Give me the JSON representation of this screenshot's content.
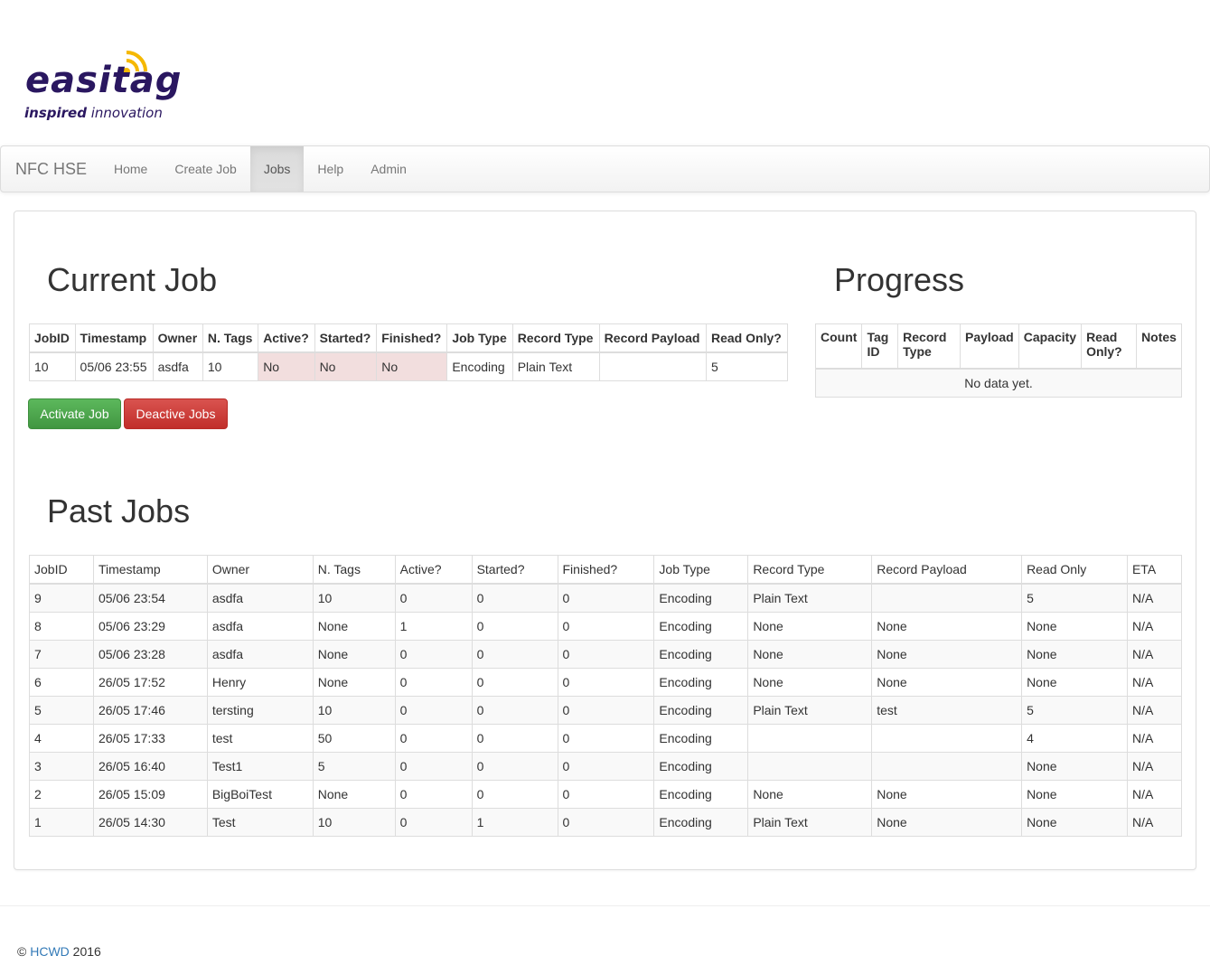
{
  "logo": {
    "word": "easitag",
    "tagline_bold": "inspired",
    "tagline_rest": " innovation"
  },
  "nav": {
    "brand": "NFC HSE",
    "links": [
      "Home",
      "Create Job",
      "Jobs",
      "Help",
      "Admin"
    ],
    "active": "Jobs"
  },
  "current_job": {
    "title": "Current Job",
    "headers": [
      "JobID",
      "Timestamp",
      "Owner",
      "N. Tags",
      "Active?",
      "Started?",
      "Finished?",
      "Job Type",
      "Record Type",
      "Record Payload",
      "Read Only?"
    ],
    "row": [
      "10",
      "05/06 23:55",
      "asdfa",
      "10",
      "No",
      "No",
      "No",
      "Encoding",
      "Plain Text",
      "",
      "5"
    ]
  },
  "buttons": {
    "activate": "Activate Job",
    "deactivate": "Deactive Jobs"
  },
  "progress": {
    "title": "Progress",
    "headers": [
      "Count",
      "Tag ID",
      "Record Type",
      "Payload",
      "Capacity",
      "Read Only?",
      "Notes"
    ],
    "empty": "No data yet."
  },
  "past_jobs": {
    "title": "Past Jobs",
    "headers": [
      "JobID",
      "Timestamp",
      "Owner",
      "N. Tags",
      "Active?",
      "Started?",
      "Finished?",
      "Job Type",
      "Record Type",
      "Record Payload",
      "Read Only",
      "ETA"
    ],
    "rows": [
      [
        "9",
        "05/06 23:54",
        "asdfa",
        "10",
        "0",
        "0",
        "0",
        "Encoding",
        "Plain Text",
        "",
        "5",
        "N/A"
      ],
      [
        "8",
        "05/06 23:29",
        "asdfa",
        "None",
        "1",
        "0",
        "0",
        "Encoding",
        "None",
        "None",
        "None",
        "N/A"
      ],
      [
        "7",
        "05/06 23:28",
        "asdfa",
        "None",
        "0",
        "0",
        "0",
        "Encoding",
        "None",
        "None",
        "None",
        "N/A"
      ],
      [
        "6",
        "26/05 17:52",
        "Henry",
        "None",
        "0",
        "0",
        "0",
        "Encoding",
        "None",
        "None",
        "None",
        "N/A"
      ],
      [
        "5",
        "26/05 17:46",
        "tersting",
        "10",
        "0",
        "0",
        "0",
        "Encoding",
        "Plain Text",
        "test",
        "5",
        "N/A"
      ],
      [
        "4",
        "26/05 17:33",
        "test",
        "50",
        "0",
        "0",
        "0",
        "Encoding",
        "",
        "",
        "4",
        "N/A"
      ],
      [
        "3",
        "26/05 16:40",
        "Test1",
        "5",
        "0",
        "0",
        "0",
        "Encoding",
        "",
        "",
        "None",
        "N/A"
      ],
      [
        "2",
        "26/05 15:09",
        "BigBoiTest",
        "None",
        "0",
        "0",
        "0",
        "Encoding",
        "None",
        "None",
        "None",
        "N/A"
      ],
      [
        "1",
        "26/05 14:30",
        "Test",
        "10",
        "0",
        "1",
        "0",
        "Encoding",
        "Plain Text",
        "None",
        "None",
        "N/A"
      ]
    ]
  },
  "footer": {
    "copy": "© ",
    "link": "HCWD",
    "year": " 2016"
  },
  "colors": {
    "brand_purple": "#2a1760",
    "brand_yellow": "#f5b800",
    "success": "#5cb85c",
    "danger": "#d9534f",
    "link": "#337ab7"
  }
}
